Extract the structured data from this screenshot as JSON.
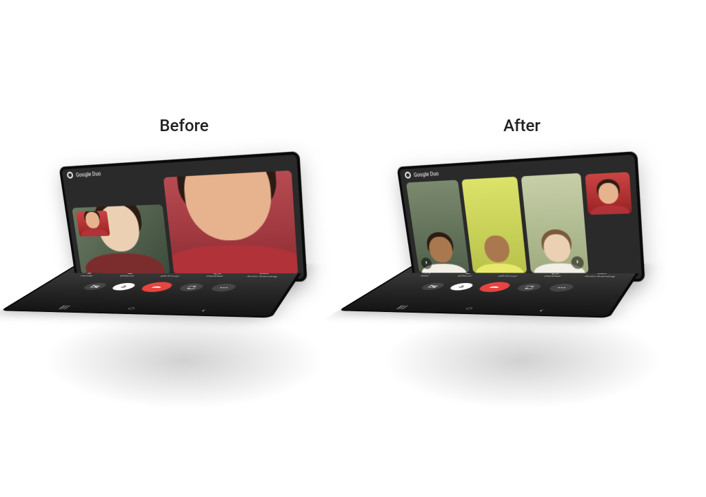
{
  "labels": {
    "before": "Before",
    "after": "After"
  },
  "app": {
    "name": "Google Duo"
  },
  "participants": {
    "indicator": "4"
  },
  "controls": {
    "items": [
      {
        "name": "add-icon",
        "label": "Add"
      },
      {
        "name": "effects-icon",
        "label": "Effects"
      },
      {
        "name": "ar-emoji-icon",
        "label": "AR Emoji"
      },
      {
        "name": "portrait-icon",
        "label": "Portrait"
      },
      {
        "name": "autoframe-icon",
        "label": "Auto-framing"
      }
    ],
    "before_first": {
      "name": "family-icon",
      "label": "Family"
    }
  },
  "main_buttons": {
    "camera_off": "camera-off-icon",
    "flip": "camera-flip-icon",
    "mic": "mic-icon",
    "end": "end-call-icon",
    "more": "more-icon"
  },
  "nav": {
    "recents": "|||",
    "home": "○",
    "back": "‹"
  },
  "colors": {
    "hangup": "#e53935",
    "bg": "#2a2a2a"
  }
}
